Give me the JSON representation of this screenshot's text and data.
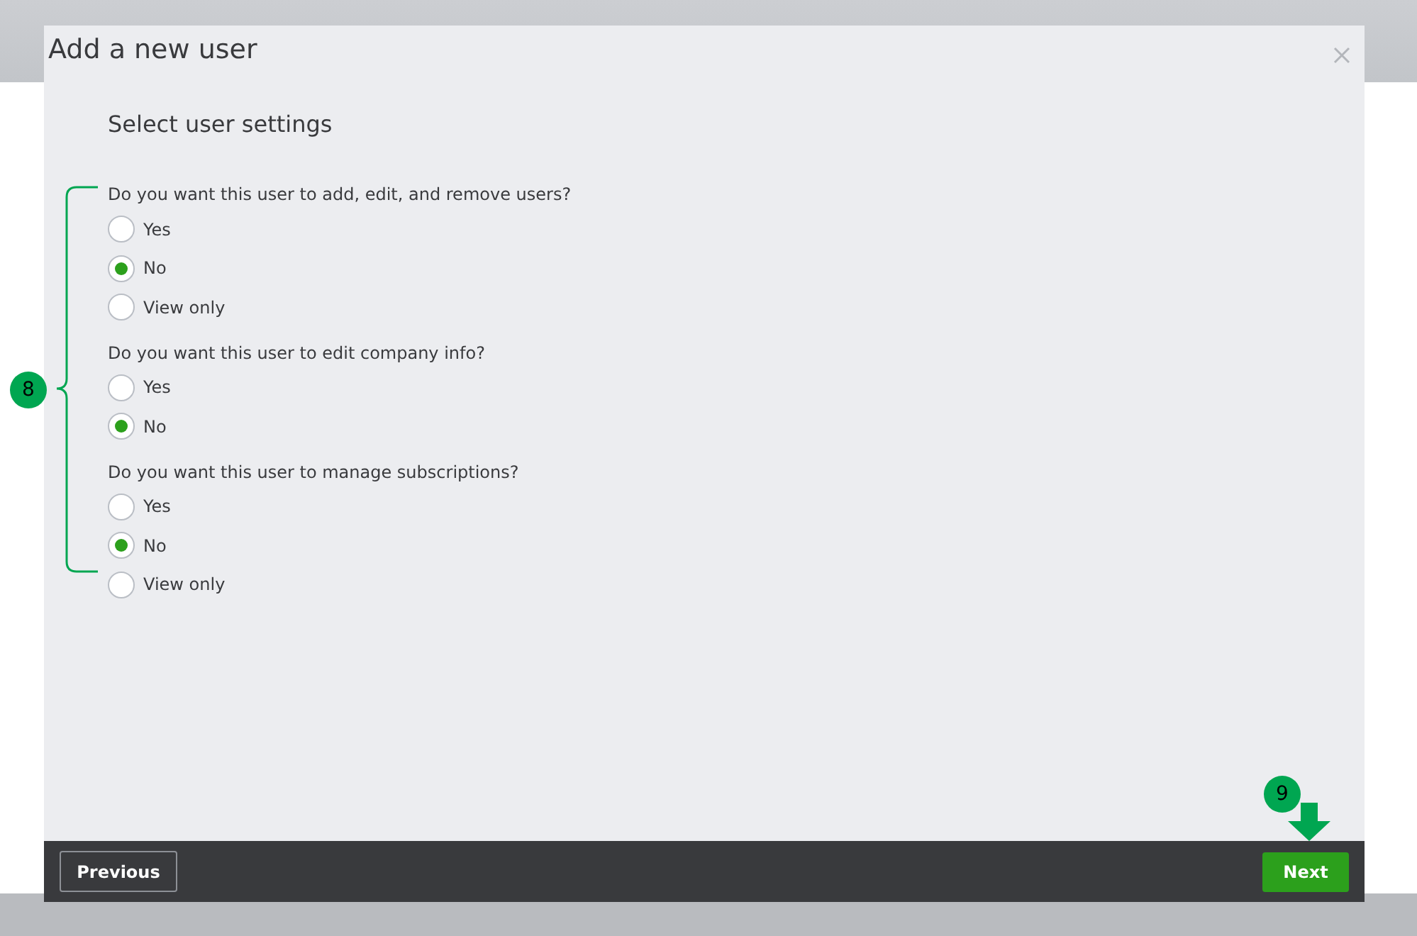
{
  "dialog": {
    "title": "Add a new user",
    "heading": "Select user settings"
  },
  "questions": [
    {
      "text": "Do you want this user to add, edit, and remove users?",
      "options": [
        {
          "label": "Yes",
          "selected": false
        },
        {
          "label": "No",
          "selected": true
        },
        {
          "label": "View only",
          "selected": false
        }
      ]
    },
    {
      "text": "Do you want this user to edit company info?",
      "options": [
        {
          "label": "Yes",
          "selected": false
        },
        {
          "label": "No",
          "selected": true
        }
      ]
    },
    {
      "text": "Do you want this user to manage subscriptions?",
      "options": [
        {
          "label": "Yes",
          "selected": false
        },
        {
          "label": "No",
          "selected": true
        },
        {
          "label": "View only",
          "selected": false
        }
      ]
    }
  ],
  "footer": {
    "previous": "Previous",
    "next": "Next"
  },
  "annotations": [
    {
      "label": "8"
    },
    {
      "label": "9"
    }
  ]
}
